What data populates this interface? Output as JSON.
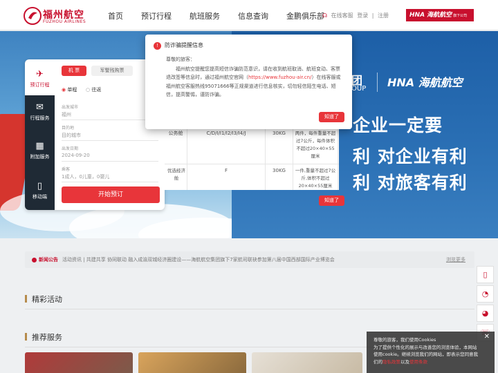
{
  "header": {
    "logo_cn": "福州航空",
    "logo_en": "FUZHOU AIRLINES",
    "nav": [
      "首页",
      "预订行程",
      "航班服务",
      "信息查询",
      "金鹏俱乐部"
    ],
    "links": {
      "service": "在线客服",
      "login": "登录",
      "sep": "|",
      "register": "注册"
    },
    "hna": "HNA 海航航空",
    "hna_small": "旗下公司"
  },
  "banner": {
    "group": "团",
    "group_en": "OUP",
    "hna": "HNA 海航航空",
    "slogan1": "企业一定要",
    "slogan2": "利  对企业有利",
    "slogan3": "利  对旅客有利"
  },
  "booking": {
    "side": [
      {
        "icon": "✈",
        "label": "预订行程"
      },
      {
        "icon": "✉",
        "label": "行程服务"
      },
      {
        "icon": "▦",
        "label": "附加服务"
      },
      {
        "icon": "▯",
        "label": "移动端"
      }
    ],
    "tabs": {
      "ticket": "机 票",
      "group": "军警残购票"
    },
    "trip": {
      "oneway": "单程",
      "round": "往返"
    },
    "from": {
      "label": "出发城市",
      "value": "福州"
    },
    "to": {
      "label": "目的地",
      "value": "目的城市"
    },
    "date": {
      "label": "出发日期",
      "value": "2024-09-20"
    },
    "pax": {
      "label": "乘客",
      "value": "1成人，0儿童，0婴儿"
    },
    "search": "开始预订"
  },
  "back_table": {
    "rows": [
      {
        "cabin": "公务舱",
        "codes": "C/D/I/I1/I2/I3/I4/J",
        "weight": "30KG",
        "note": "两件，每件重量不超过7公斤，每件体积不超过20×40×55厘米"
      },
      {
        "cabin": "优选经济舱",
        "codes": "F",
        "weight": "30KG",
        "note": "一件,重量不超过7公斤,体积不超过20×40×55厘米"
      }
    ],
    "button": "知道了"
  },
  "modal": {
    "title": "防诈骗提醒信息",
    "greeting": "尊敬的旅客：",
    "body_pre": "福州航空提醒您提高短信诈骗防范意识，请在收到航班取消、航班变动、客票退改签等信息时，通过福州航空官网（",
    "link": "https://www.fuzhou-air.cn/",
    "body_post": "）在线客服或福州航空客服热线95071666等正规渠道进行信息核实，切勿轻信陌生电话、短信，提高警惕，谨防诈骗。",
    "button": "知道了"
  },
  "news": {
    "label": "新闻公告",
    "text": "活动资讯 | 共建共享 协同联动 融入成渝双城经济圈建设——海航航空集团旗下7家航司联袂参加第八届中国西部国际产业博览会",
    "more": "浏览更多"
  },
  "sections": {
    "activities": "精彩活动",
    "services": "推荐服务"
  },
  "float_icons": [
    "phone-icon",
    "wechat-icon",
    "weibo-icon",
    "service-icon"
  ],
  "cookie": {
    "text1": "尊敬的旅客，我们使用Cookies",
    "text2": "为了提供个性化的展示与改善您的浏览体验，本网站使用cookie。继续浏览我们的网站，即表示您同意我们的",
    "link1": "隐私政策",
    "mid": "以及",
    "link2": "使用条款",
    "close": "✕"
  },
  "colors": {
    "brand": "#c8102e",
    "button": "#e8353a",
    "gold": "#b68b4c"
  }
}
